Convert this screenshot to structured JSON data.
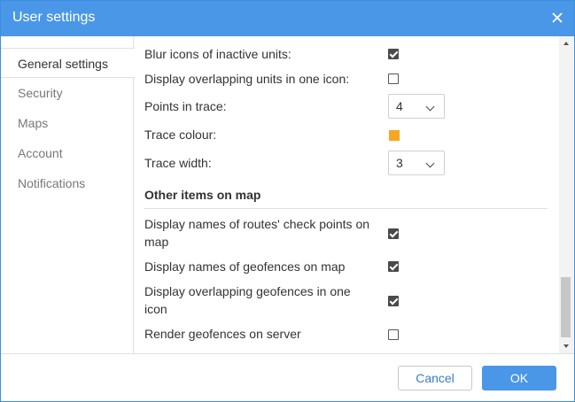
{
  "window": {
    "title": "User settings"
  },
  "sidebar": {
    "tabs": [
      {
        "label": "General settings",
        "active": true
      },
      {
        "label": "Security"
      },
      {
        "label": "Maps"
      },
      {
        "label": "Account"
      },
      {
        "label": "Notifications"
      }
    ]
  },
  "settings": {
    "blur_icons": {
      "label": "Blur icons of inactive units:",
      "checked": true
    },
    "overlapping_units": {
      "label": "Display overlapping units in one icon:",
      "checked": false
    },
    "points_in_trace": {
      "label": "Points in trace:",
      "value": "4"
    },
    "trace_colour": {
      "label": "Trace colour:",
      "color": "#f5a623"
    },
    "trace_width": {
      "label": "Trace width:",
      "value": "3"
    }
  },
  "map_items": {
    "heading": "Other items on map",
    "check_points_line1": "Display names of routes' check points on",
    "check_points_line2": "map",
    "check_points_checked": true,
    "geofence_names": {
      "label": "Display names of geofences on map",
      "checked": true
    },
    "overlap_geofences_line1": "Display overlapping geofences in one",
    "overlap_geofences_line2": "icon",
    "overlap_geofences_checked": true,
    "render_geofences": {
      "label": "Render geofences on server",
      "checked": false
    }
  },
  "footer": {
    "cancel_label": "Cancel",
    "ok_label": "OK"
  },
  "colors": {
    "accent": "#4a97e8",
    "border": "#3c8fde"
  }
}
